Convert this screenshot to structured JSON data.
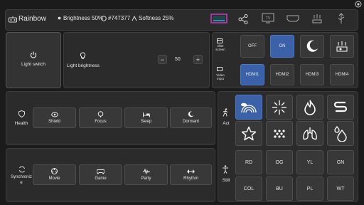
{
  "header": {
    "title": "Rainbow",
    "brightness": "Brightness 50%",
    "color": "#747377",
    "softness": "Softness 25%"
  },
  "light_switch": {
    "label": "Light switch"
  },
  "light_brightness": {
    "label": "Light brightness",
    "value": "50",
    "minus": "−",
    "plus": "+"
  },
  "after_screen": {
    "label": "After screen",
    "off": "OFF",
    "on": "ON"
  },
  "video_input": {
    "label": "Video input",
    "inputs": [
      "HDMI1",
      "HDMI2",
      "HDMI3",
      "HDMI4"
    ]
  },
  "health": {
    "label": "Health",
    "items": [
      "Shield",
      "Focus",
      "Sleep",
      "Dormant"
    ]
  },
  "sync": {
    "label": "Synchronize",
    "items": [
      "Movie",
      "Game",
      "Party",
      "Rhythm"
    ]
  },
  "act": {
    "label": "Act"
  },
  "still": {
    "label": "Still",
    "colors": [
      "RD",
      "OG",
      "YL",
      "GN",
      "COL",
      "BU",
      "PL",
      "WT"
    ]
  },
  "accent": "#3b62a8"
}
